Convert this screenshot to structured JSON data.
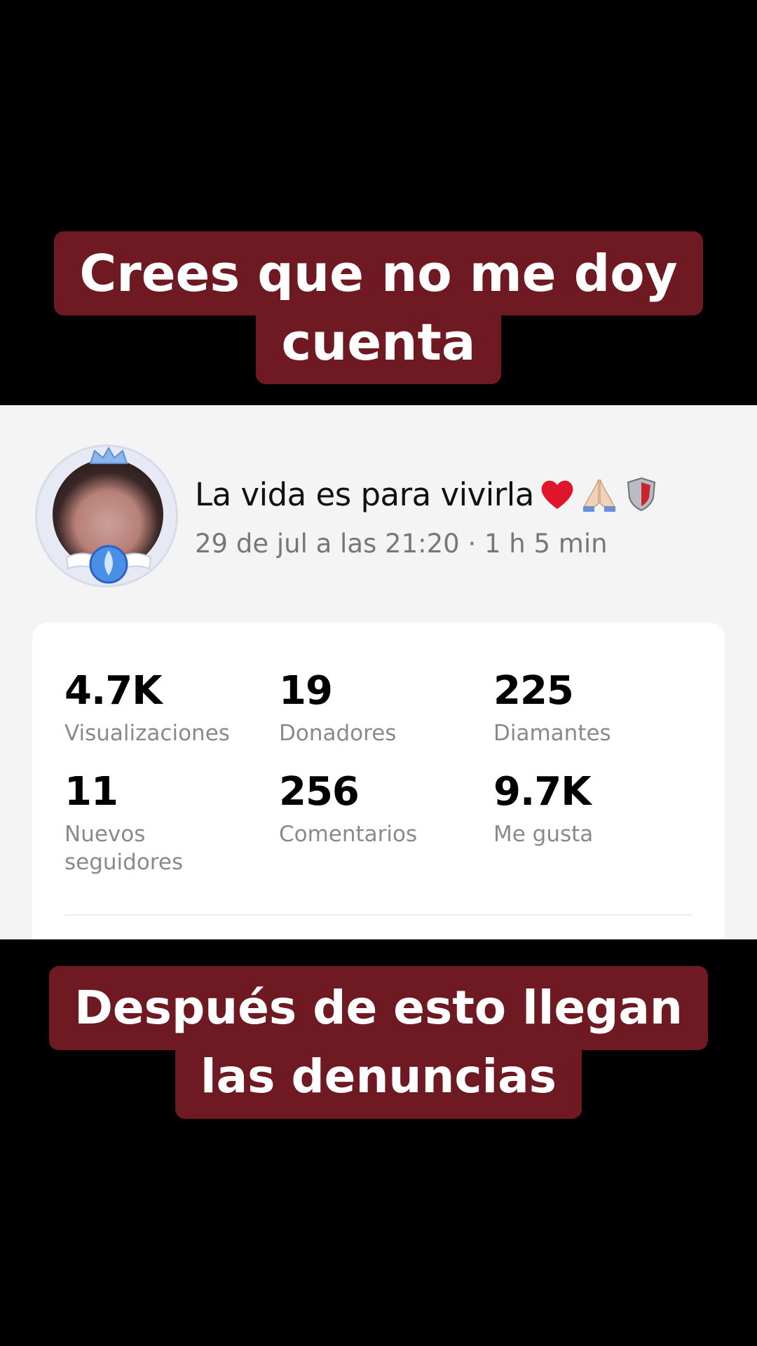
{
  "captions": {
    "top": [
      "Crees que no me doy",
      "cuenta"
    ],
    "bottom": [
      "Después de esto llegan",
      "las denuncias"
    ]
  },
  "profile": {
    "name": "La vida es para vivirla",
    "name_emojis": [
      "red-heart-icon",
      "folded-hands-icon",
      "shield-icon"
    ],
    "meta": "29 de jul a las 21:20 · 1 h 5 min"
  },
  "stats": [
    {
      "value": "4.7K",
      "label": "Visualizaciones"
    },
    {
      "value": "19",
      "label": "Donadores"
    },
    {
      "value": "225",
      "label": "Diamantes"
    },
    {
      "value": "11",
      "label": "Nuevos seguidores"
    },
    {
      "value": "256",
      "label": "Comentarios"
    },
    {
      "value": "9.7K",
      "label": "Me gusta"
    }
  ],
  "colors": {
    "caption_bg": "#6f1a22",
    "panel_bg": "#f4f4f4",
    "card_bg": "#ffffff"
  }
}
